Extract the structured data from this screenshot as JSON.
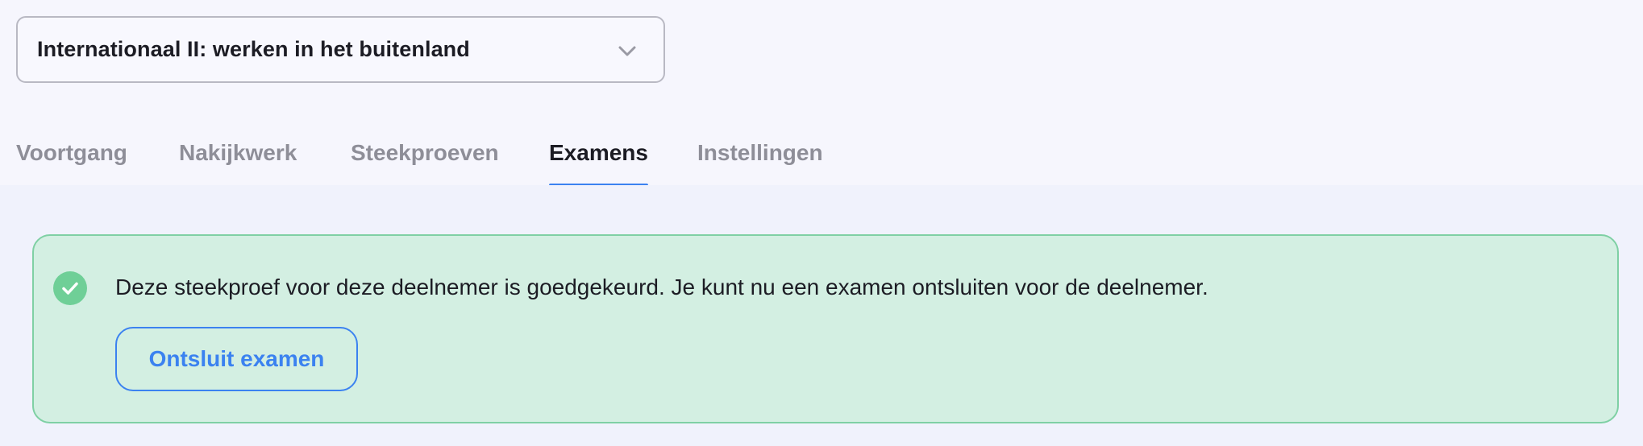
{
  "course_select": {
    "selected": "Internationaal II: werken in het buitenland",
    "icon": "chevron-down-icon"
  },
  "tabs": [
    {
      "label": "Voortgang",
      "active": false
    },
    {
      "label": "Nakijkwerk",
      "active": false
    },
    {
      "label": "Steekproeven",
      "active": false
    },
    {
      "label": "Examens",
      "active": true
    },
    {
      "label": "Instellingen",
      "active": false
    }
  ],
  "alert": {
    "icon": "check-circle-icon",
    "message": "Deze steekproef voor deze deelnemer is goedgekeurd. Je kunt nu een examen ontsluiten voor de deelnemer.",
    "button_label": "Ontsluit examen"
  },
  "colors": {
    "accent": "#3b82f0",
    "success_bg": "#d3efe2",
    "success_border": "#7fd0a4",
    "success_icon": "#6fcf97"
  }
}
